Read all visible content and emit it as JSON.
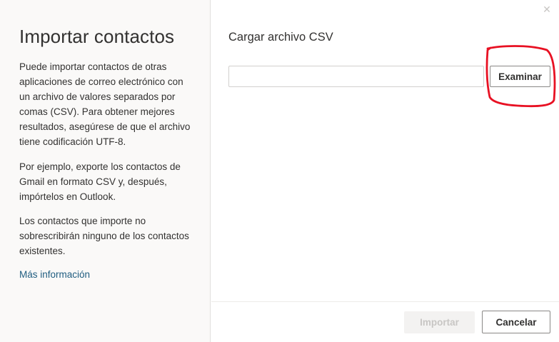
{
  "dialog": {
    "title": "Importar contactos",
    "description_1": "Puede importar contactos de otras aplicaciones de correo electrónico con un archivo de valores separados por comas (CSV). Para obtener mejores resultados, asegúrese de que el archivo tiene codificación UTF-8.",
    "description_2": "Por ejemplo, exporte los contactos de Gmail en formato CSV y, después, impórtelos en Outlook.",
    "description_3": "Los contactos que importe no sobrescribirán ninguno de los contactos existentes.",
    "more_info_link": "Más información",
    "close_icon": "close-icon",
    "close_glyph": "✕"
  },
  "upload": {
    "section_title": "Cargar archivo CSV",
    "file_value": "",
    "browse_label": "Examinar",
    "annotation_color": "#e81123"
  },
  "footer": {
    "import_label": "Importar",
    "cancel_label": "Cancelar"
  }
}
